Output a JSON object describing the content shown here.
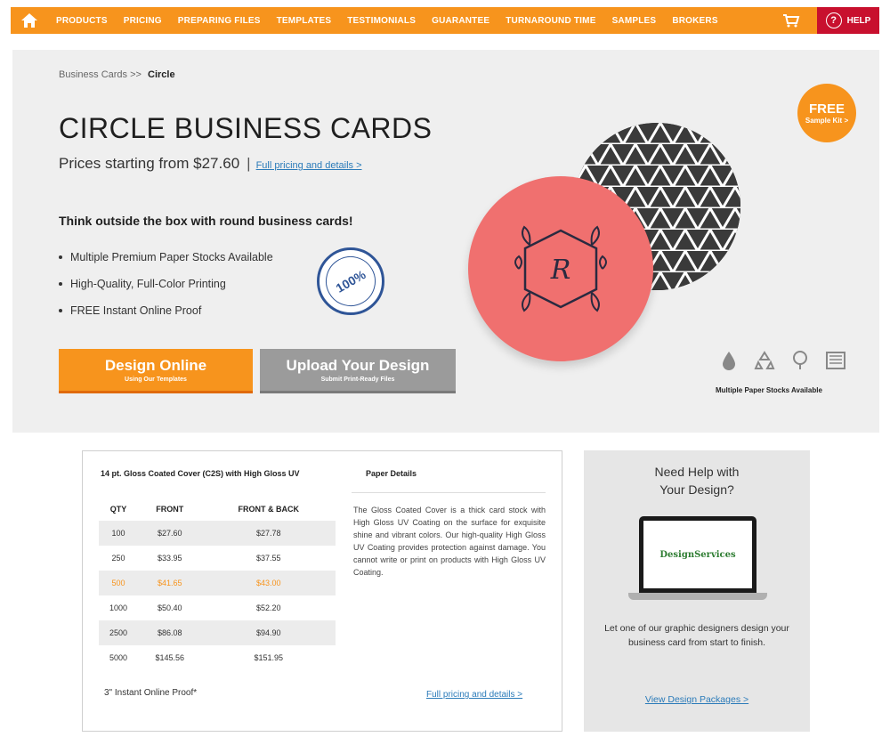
{
  "nav": {
    "items": [
      "PRODUCTS",
      "PRICING",
      "PREPARING FILES",
      "TEMPLATES",
      "TESTIMONIALS",
      "GUARANTEE",
      "TURNAROUND TIME",
      "SAMPLES",
      "BROKERS"
    ],
    "help_label": "HELP",
    "accent": "#f7941d",
    "help_color": "#c8102e"
  },
  "breadcrumb": {
    "parent": "Business Cards >>",
    "current": "Circle"
  },
  "hero": {
    "title": "CIRCLE BUSINESS CARDS",
    "price_text": "Prices starting from $27.60",
    "price_sep": "|",
    "pricing_link": "Full pricing and details >",
    "tagline": "Think outside the box with round business cards!",
    "bullets": [
      "Multiple Premium Paper Stocks Available",
      "High-Quality, Full-Color Printing",
      "FREE Instant Online Proof"
    ],
    "seal_text": "100%",
    "free_badge": {
      "big": "FREE",
      "small": "Sample Kit >"
    },
    "monogram": "R",
    "design_button": {
      "main": "Design Online",
      "sub": "Using Our Templates"
    },
    "upload_button": {
      "main": "Upload Your Design",
      "sub": "Submit Print-Ready Files"
    },
    "eco_caption": "Multiple Paper Stocks Available"
  },
  "pricing": {
    "stock_title": "14 pt. Gloss Coated Cover (C2S) with High Gloss UV",
    "headers": [
      "QTY",
      "FRONT",
      "FRONT & BACK"
    ],
    "rows": [
      [
        "100",
        "$27.60",
        "$27.78"
      ],
      [
        "250",
        "$33.95",
        "$37.55"
      ],
      [
        "500",
        "$41.65",
        "$43.00"
      ],
      [
        "1000",
        "$50.40",
        "$52.20"
      ],
      [
        "2500",
        "$86.08",
        "$94.90"
      ],
      [
        "5000",
        "$145.56",
        "$151.95"
      ]
    ],
    "highlight_row": 2,
    "proof": "3\" Instant Online Proof*",
    "details_title": "Paper Details",
    "details_text": "The Gloss Coated Cover is a thick card stock with High Gloss UV Coating on the surface for exquisite shine and vibrant colors. Our high-quality High Gloss UV Coating provides protection against damage. You cannot write or print on products with High Gloss UV Coating.",
    "full_link": "Full pricing and details >"
  },
  "help_box": {
    "heading_line1": "Need Help with",
    "heading_line2": "Your Design?",
    "screen_logo": "DesignServices",
    "description": "Let one of our graphic designers design your business card from start to finish.",
    "link": "View Design Packages >"
  }
}
